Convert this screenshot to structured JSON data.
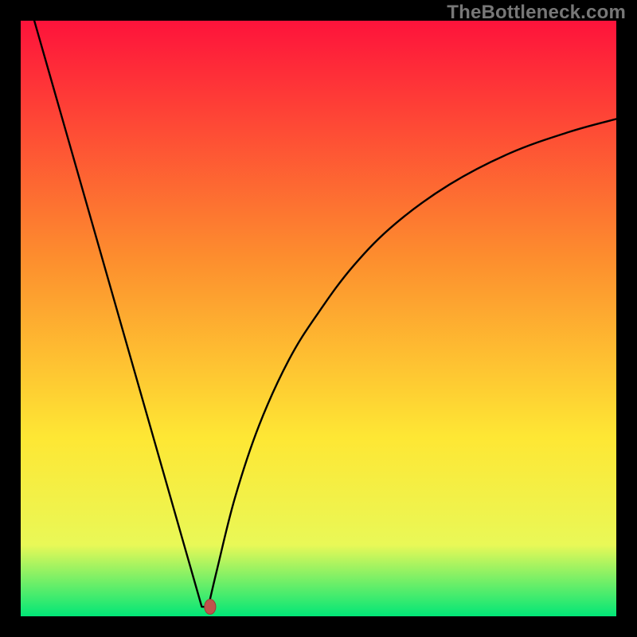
{
  "watermark": "TheBottleneck.com",
  "colors": {
    "frame_bg": "#000000",
    "gradient_top": "#fe133b",
    "gradient_mid1": "#fd8e2e",
    "gradient_mid2": "#fee734",
    "gradient_mid3": "#e9f857",
    "gradient_bottom": "#01e677",
    "curve": "#000000",
    "marker_fill": "#bf534c",
    "marker_stroke": "#9a3d38",
    "watermark_text": "#777777"
  },
  "chart_data": {
    "type": "line",
    "title": "",
    "xlabel": "",
    "ylabel": "",
    "xlim": [
      0,
      100
    ],
    "ylim": [
      0,
      100
    ],
    "grid": false,
    "legend": false,
    "series": [
      {
        "name": "bottleneck-curve",
        "x": [
          0,
          4,
          8,
          12,
          16,
          20,
          24,
          27,
          29,
          30.4,
          31.5,
          33,
          36,
          40,
          45,
          50,
          56,
          63,
          72,
          82,
          92,
          100
        ],
        "y": [
          108,
          94,
          80,
          66,
          52,
          38,
          24,
          13.5,
          6.5,
          1.6,
          1.6,
          8,
          20,
          32,
          43,
          51,
          59,
          66,
          72.5,
          77.7,
          81.3,
          83.5
        ]
      }
    ],
    "annotations": [
      {
        "type": "flat-valley-segment",
        "x_from": 30.4,
        "x_to": 31.5,
        "y": 1.6
      }
    ],
    "marker": {
      "x": 31.8,
      "y": 1.6,
      "rx": 0.95,
      "ry": 1.25
    }
  }
}
